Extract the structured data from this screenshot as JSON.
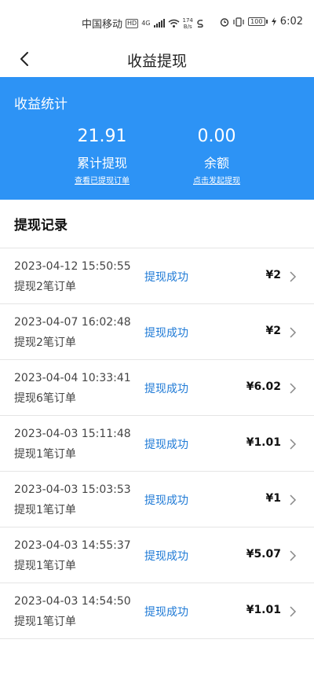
{
  "status_bar": {
    "carrier": "中国移动",
    "hd": "HD",
    "network": "4G",
    "speed_value": "174",
    "speed_unit": "B/s",
    "battery": "100",
    "time": "6:02"
  },
  "header": {
    "title": "收益提现",
    "back_icon": "chevron-left-icon"
  },
  "stats": {
    "title": "收益统计",
    "total_withdrawn": {
      "value": "21.91",
      "label": "累计提现",
      "link": "查看已提现订单"
    },
    "balance": {
      "value": "0.00",
      "label": "余额",
      "link": "点击发起提现"
    },
    "background_color": "#2d93f5"
  },
  "records_section": {
    "title": "提现记录",
    "items": [
      {
        "datetime": "2023-04-12 15:50:55",
        "desc": "提现2笔订单",
        "status": "提现成功",
        "amount": "¥2"
      },
      {
        "datetime": "2023-04-07 16:02:48",
        "desc": "提现2笔订单",
        "status": "提现成功",
        "amount": "¥2"
      },
      {
        "datetime": "2023-04-04 10:33:41",
        "desc": "提现6笔订单",
        "status": "提现成功",
        "amount": "¥6.02"
      },
      {
        "datetime": "2023-04-03 15:11:48",
        "desc": "提现1笔订单",
        "status": "提现成功",
        "amount": "¥1.01"
      },
      {
        "datetime": "2023-04-03 15:03:53",
        "desc": "提现1笔订单",
        "status": "提现成功",
        "amount": "¥1"
      },
      {
        "datetime": "2023-04-03 14:55:37",
        "desc": "提现1笔订单",
        "status": "提现成功",
        "amount": "¥5.07"
      },
      {
        "datetime": "2023-04-03 14:54:50",
        "desc": "提现1笔订单",
        "status": "提现成功",
        "amount": "¥1.01"
      }
    ]
  }
}
